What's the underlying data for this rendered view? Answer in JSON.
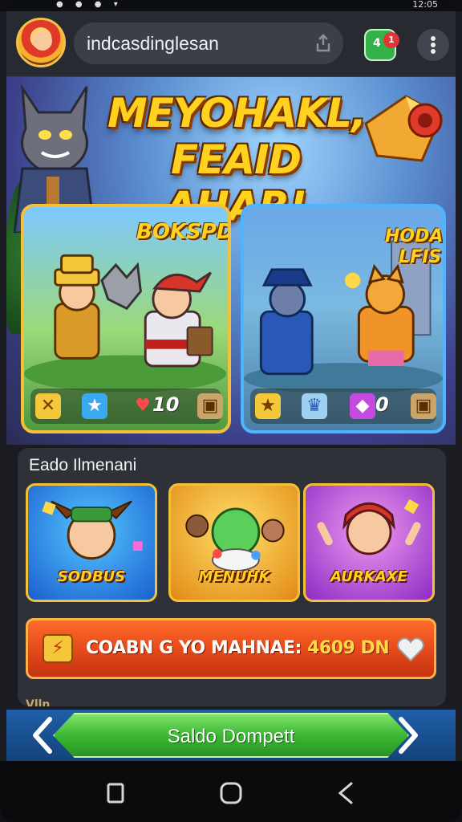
{
  "status_bar": {
    "time": "12:05"
  },
  "browser": {
    "url": "indcasdinglesan",
    "tab_count": "4",
    "tab_badge": "1"
  },
  "hero": {
    "headline_line1": "MEYOHAKL,",
    "headline_line2": "FEAID AHAR!",
    "card_left": {
      "title": "BOKSPD",
      "stat_value": "10"
    },
    "card_right": {
      "title": "HODAE\nLFIS",
      "stat_value": "0"
    }
  },
  "section": {
    "title": "Eado Ilmenani",
    "tiles": [
      {
        "label": "SODBUS"
      },
      {
        "label": "MENUHK"
      },
      {
        "label": "AURKAXE"
      }
    ],
    "promo": {
      "text": "COABN G YO MAHNAE:",
      "amount": "4609 DN"
    },
    "sub_text": "Vlln"
  },
  "wallet": {
    "label": "Saldo Dompett"
  },
  "icons": {
    "menu": "more-vert-icon",
    "share": "share-icon",
    "nav_recents": "square-recents-icon",
    "nav_home": "circle-home-icon",
    "nav_back": "triangle-back-icon"
  },
  "colors": {
    "accent_gold": "#ffd21f",
    "wallet_green": "#3cb834",
    "promo_orange": "#e4481a",
    "header_bg": "#272a31"
  }
}
